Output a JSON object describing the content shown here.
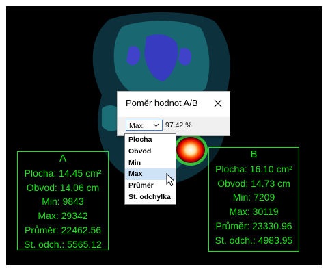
{
  "dialog": {
    "title": "Poměr hodnot A/B",
    "selected_mode": "Max:",
    "ratio_value": "97.42 %"
  },
  "dropdown": {
    "options": [
      "Plocha",
      "Obvod",
      "Min",
      "Max",
      "Průměr",
      "St. odchylka"
    ],
    "highlighted": "Max"
  },
  "roi_a": {
    "label": "A",
    "area": "Plocha: 14.45 cm²",
    "perimeter": "Obvod: 14.06 cm",
    "min": "Min: 9843",
    "max": "Max: 29342",
    "mean": "Průměr: 22462.56",
    "std": "St. odch.: 5565.12"
  },
  "roi_b": {
    "label": "B",
    "area": "Plocha: 16.10 cm²",
    "perimeter": "Obvod: 14.73 cm",
    "min": "Min: 7209",
    "max": "Max: 30119",
    "mean": "Průměr: 23330.96",
    "std": "St. odch.: 4983.95"
  },
  "colors": {
    "roi_text": "#19e619",
    "background": "#000000",
    "selection": "#cfe3f7"
  }
}
